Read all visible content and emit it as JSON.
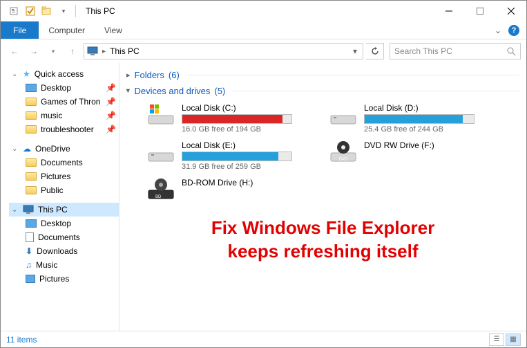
{
  "window": {
    "title": "This PC",
    "qa_props": "Properties",
    "qa_new": "New"
  },
  "ribbon": {
    "file": "File",
    "tabs": [
      "Computer",
      "View"
    ]
  },
  "address": {
    "text": "This PC"
  },
  "search": {
    "placeholder": "Search This PC"
  },
  "sidebar": {
    "quick_access": "Quick access",
    "quick_items": [
      "Desktop",
      "Games of Thron",
      "music",
      "troubleshooter"
    ],
    "onedrive": "OneDrive",
    "onedrive_items": [
      "Documents",
      "Pictures",
      "Public"
    ],
    "this_pc": "This PC",
    "pc_items": [
      "Desktop",
      "Documents",
      "Downloads",
      "Music",
      "Pictures"
    ]
  },
  "groups": {
    "folders": {
      "label": "Folders",
      "count": "(6)"
    },
    "drives": {
      "label": "Devices and drives",
      "count": "(5)"
    }
  },
  "drives": [
    {
      "name": "Local Disk (C:)",
      "free": "16.0 GB free of 194 GB",
      "fill": 92,
      "color": "red",
      "icon": "win"
    },
    {
      "name": "Local Disk (D:)",
      "free": "25.4 GB free of 244 GB",
      "fill": 90,
      "color": "blue",
      "icon": "hdd"
    },
    {
      "name": "Local Disk (E:)",
      "free": "31.9 GB free of 259 GB",
      "fill": 88,
      "color": "blue",
      "icon": "hdd"
    },
    {
      "name": "DVD RW Drive (F:)",
      "free": "",
      "fill": 0,
      "color": "none",
      "icon": "dvd"
    },
    {
      "name": "BD-ROM Drive (H:)",
      "free": "",
      "fill": 0,
      "color": "none",
      "icon": "bd"
    }
  ],
  "overlay": {
    "line1": "Fix Windows File Explorer",
    "line2": "keeps refreshing itself"
  },
  "status": {
    "count": "11 items"
  }
}
